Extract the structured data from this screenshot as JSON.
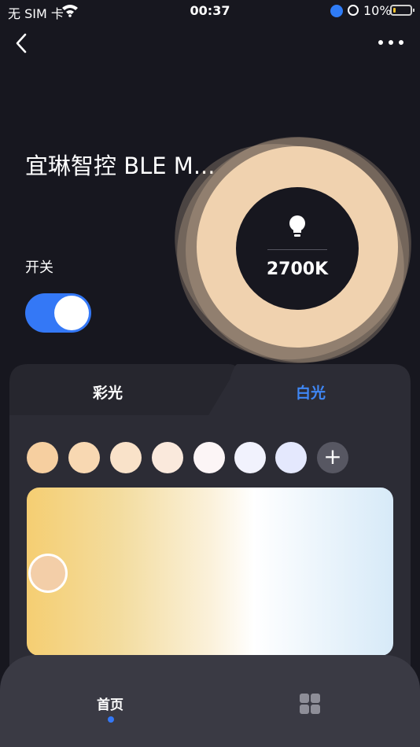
{
  "status_bar": {
    "carrier": "无 SIM 卡",
    "time": "00:37",
    "battery_percent": "10%",
    "battery_level": 0.1,
    "battery_color": "#f2c230"
  },
  "header": {
    "back_icon": "chevron-left-icon",
    "more_icon": "ellipsis-icon"
  },
  "device": {
    "title": "宜琳智控 BLE M...",
    "power_label": "开关",
    "power_on": true,
    "color_temperature": "2700K",
    "ring_color": "#f0d2af"
  },
  "tabs": [
    {
      "label": "彩光",
      "active": false
    },
    {
      "label": "白光",
      "active": true
    }
  ],
  "presets": {
    "colors": [
      "#f6cfa0",
      "#f8d8b2",
      "#f9e2c9",
      "#fae9dc",
      "#fcf5f6",
      "#f1f2fd",
      "#e4e8fd"
    ],
    "add_icon": "plus-icon"
  },
  "slider": {
    "gradient": [
      "#f5ce72",
      "#ffffff",
      "#d7eaf8"
    ],
    "position": 0.05
  },
  "bottom_nav": {
    "home_label": "首页",
    "grid_icon": "grid-icon",
    "accent": "#3478f6"
  }
}
